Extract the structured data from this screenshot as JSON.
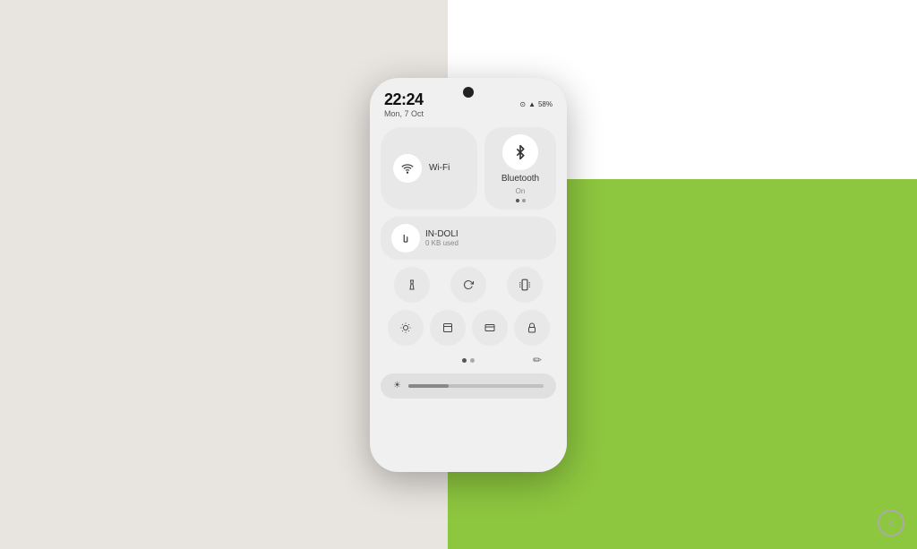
{
  "background": {
    "left_color": "#e8e4e0",
    "right_color": "#8dc63f"
  },
  "phone": {
    "status_bar": {
      "time": "22:24",
      "date": "Mon, 7 Oct",
      "battery": "58%",
      "icons": [
        "wifi",
        "signal",
        "battery"
      ]
    },
    "quick_settings": {
      "wifi_tile": {
        "icon": "wifi",
        "label": "Wi-Fi"
      },
      "bluetooth_tile": {
        "icon": "bluetooth",
        "label": "Bluetooth",
        "sublabel": "On"
      },
      "mobile_data_tile": {
        "icon": "data",
        "label": "IN-DOLI",
        "sublabel": "0 KB used"
      },
      "icon_tiles": [
        {
          "icon": "flashlight",
          "label": "Flashlight"
        },
        {
          "icon": "rotate",
          "label": "Rotate"
        },
        {
          "icon": "vibrate",
          "label": "Vibrate"
        }
      ],
      "icon_tiles_row2": [
        {
          "icon": "brightness",
          "label": "Brightness"
        },
        {
          "icon": "screenshot",
          "label": "Screenshot"
        },
        {
          "icon": "wallet",
          "label": "Wallet"
        },
        {
          "icon": "lock",
          "label": "Lock"
        }
      ],
      "brightness_slider": {
        "icon": "sun",
        "value": 30
      }
    }
  },
  "watermark": {
    "symbol": "⊙"
  }
}
